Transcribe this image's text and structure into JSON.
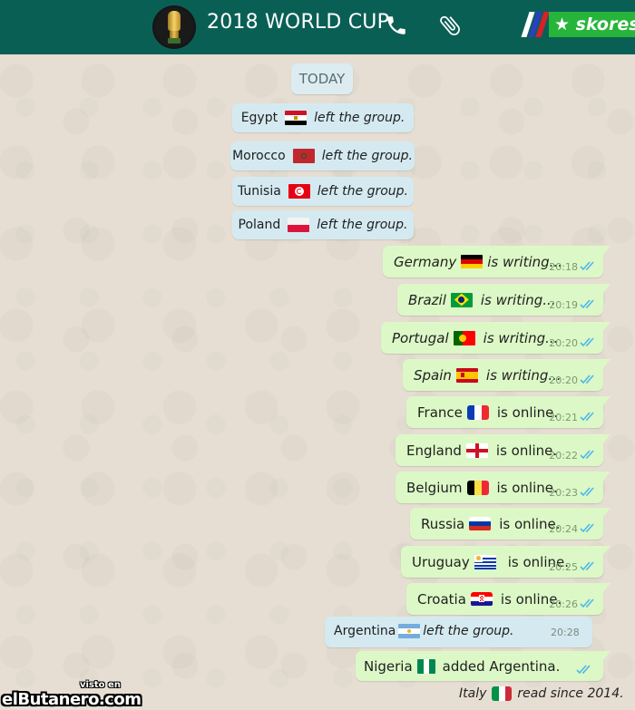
{
  "header": {
    "title": "2018 WORLD CUP",
    "avatar_icon": "trophy-icon",
    "call_icon": "phone-icon",
    "attach_icon": "paperclip-icon",
    "brand": "★ skores",
    "brand_colors": [
      "#ffffff",
      "#2b3fbf",
      "#d8202a"
    ],
    "brand_bg": "#27b43a",
    "bar_color": "#0a5f55"
  },
  "chat": {
    "date_chip": "TODAY",
    "system_messages": [
      {
        "country": "Egypt",
        "flag": "egypt",
        "text": "left the group."
      },
      {
        "country": "Morocco",
        "flag": "morocco",
        "text": "left the group."
      },
      {
        "country": "Tunisia",
        "flag": "tunisia",
        "text": "left the group."
      },
      {
        "country": "Poland",
        "flag": "poland",
        "text": "left the group."
      }
    ],
    "outgoing_messages": [
      {
        "country": "Germany",
        "flag": "germany",
        "text": "is writing...",
        "time": "20:18",
        "status": "double-check-icon"
      },
      {
        "country": "Brazil",
        "flag": "brazil",
        "text": "is writing...",
        "time": "20:19",
        "status": "double-check-icon"
      },
      {
        "country": "Portugal",
        "flag": "portugal",
        "text": "is writing...",
        "time": "20:20",
        "status": "double-check-icon"
      },
      {
        "country": "Spain",
        "flag": "spain",
        "text": "is writing...",
        "time": "20:20",
        "status": "double-check-icon"
      },
      {
        "country": "France",
        "flag": "france",
        "text": "is online.",
        "time": "20:21",
        "status": "double-check-icon"
      },
      {
        "country": "England",
        "flag": "england",
        "text": "is online.",
        "time": "20:22",
        "status": "double-check-icon"
      },
      {
        "country": "Belgium",
        "flag": "belgium",
        "text": "is online.",
        "time": "20:23",
        "status": "double-check-icon"
      },
      {
        "country": "Russia",
        "flag": "russia",
        "text": "is online.",
        "time": "20:24",
        "status": "double-check-icon"
      },
      {
        "country": "Uruguay",
        "flag": "uruguay",
        "text": "is online.",
        "time": "20:25",
        "status": "double-check-icon"
      },
      {
        "country": "Croatia",
        "flag": "croatia",
        "text": "is online.",
        "time": "20:26",
        "status": "double-check-icon"
      }
    ],
    "argentina_message": {
      "country": "Argentina",
      "flag": "argentina",
      "text": "left the group.",
      "time": "20:28"
    },
    "nigeria_message": {
      "country": "Nigeria",
      "flag": "nigeria",
      "text": "added Argentina.",
      "status": "double-check-icon"
    },
    "read_receipt": {
      "country": "Italy",
      "flag": "italy",
      "text": "read since 2014."
    }
  },
  "watermark": {
    "small": "visto en",
    "big": "elButanero.com"
  },
  "colors": {
    "outgoing_bubble": "#dcf8c6",
    "system_bubble": "#d4eaf0",
    "tick_blue": "#4fb6ec",
    "time_gray": "#7a9a72"
  }
}
